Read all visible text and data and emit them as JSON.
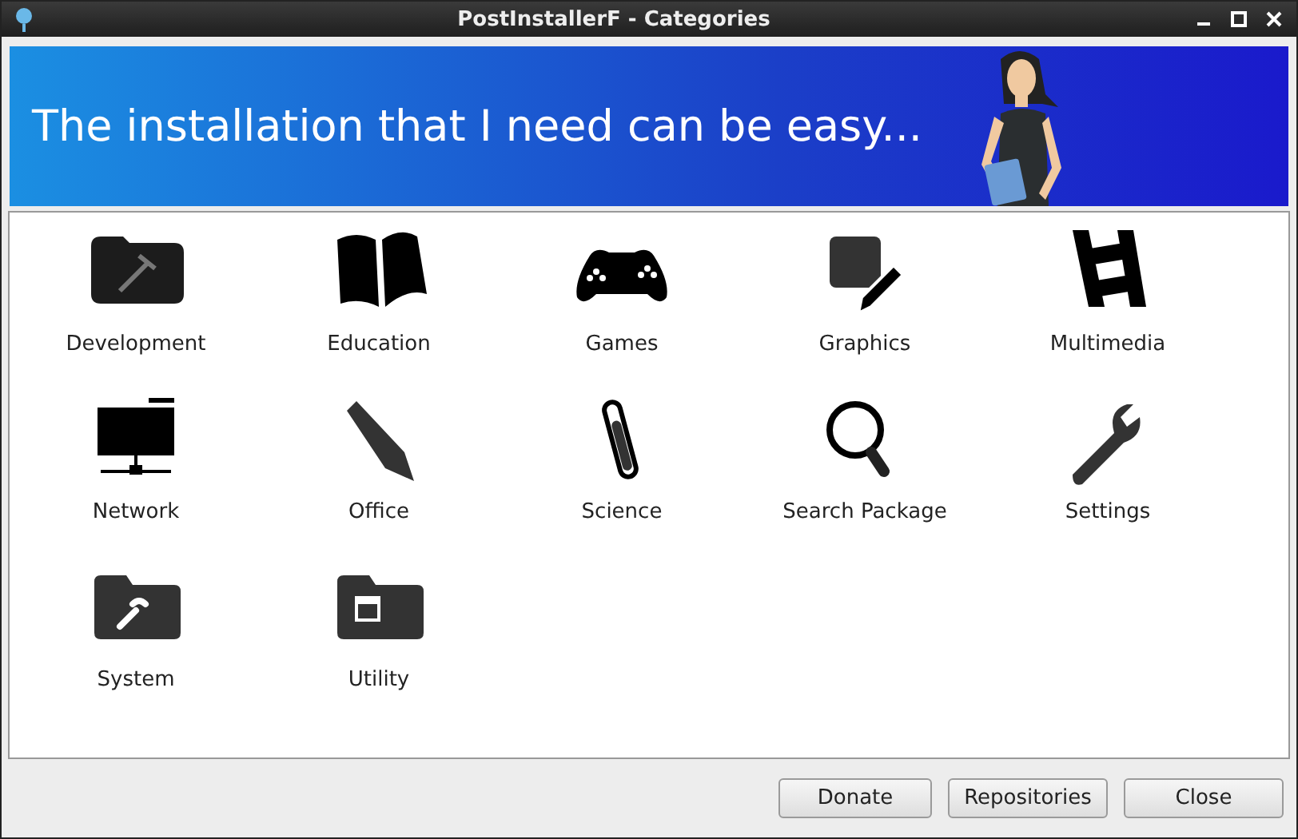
{
  "window": {
    "title": "PostInstallerF - Categories"
  },
  "banner": {
    "text": "The installation that I need can be easy..."
  },
  "categories": [
    {
      "label": "Development"
    },
    {
      "label": "Education"
    },
    {
      "label": "Games"
    },
    {
      "label": "Graphics"
    },
    {
      "label": "Multimedia"
    },
    {
      "label": "Network"
    },
    {
      "label": "Office"
    },
    {
      "label": "Science"
    },
    {
      "label": "Search Package"
    },
    {
      "label": "Settings"
    },
    {
      "label": "System"
    },
    {
      "label": "Utility"
    }
  ],
  "buttons": [
    "Donate",
    "Repositories",
    "Close"
  ]
}
